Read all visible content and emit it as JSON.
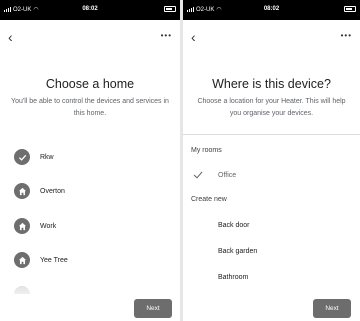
{
  "left": {
    "status": {
      "carrier": "O2-UK",
      "time": "08:02"
    },
    "title": "Choose a home",
    "subtitle": "You'll be able to control the devices and services in this home.",
    "homes": [
      {
        "label": "Rkw",
        "selected": true
      },
      {
        "label": "Overton",
        "selected": false
      },
      {
        "label": "Work",
        "selected": false
      },
      {
        "label": "Yee Tree",
        "selected": false
      }
    ],
    "next_label": "Next"
  },
  "right": {
    "status": {
      "carrier": "O2-UK",
      "time": "08:02"
    },
    "title": "Where is this device?",
    "subtitle": "Choose a location for your Heater. This will help you organise your devices.",
    "my_rooms_label": "My rooms",
    "my_rooms": [
      {
        "label": "Office",
        "selected": true
      }
    ],
    "create_new_label": "Create new",
    "create_new": [
      {
        "label": "Back door"
      },
      {
        "label": "Back garden"
      },
      {
        "label": "Bathroom"
      }
    ],
    "next_label": "Next"
  },
  "colors": {
    "button": "#6d6d6d",
    "avatar": "#6e6e6e",
    "status_bar": "#000000"
  },
  "icons": {
    "back": "chevron-left-icon",
    "more": "more-horizontal-icon",
    "selected": "checkmark-icon",
    "home": "house-icon"
  }
}
